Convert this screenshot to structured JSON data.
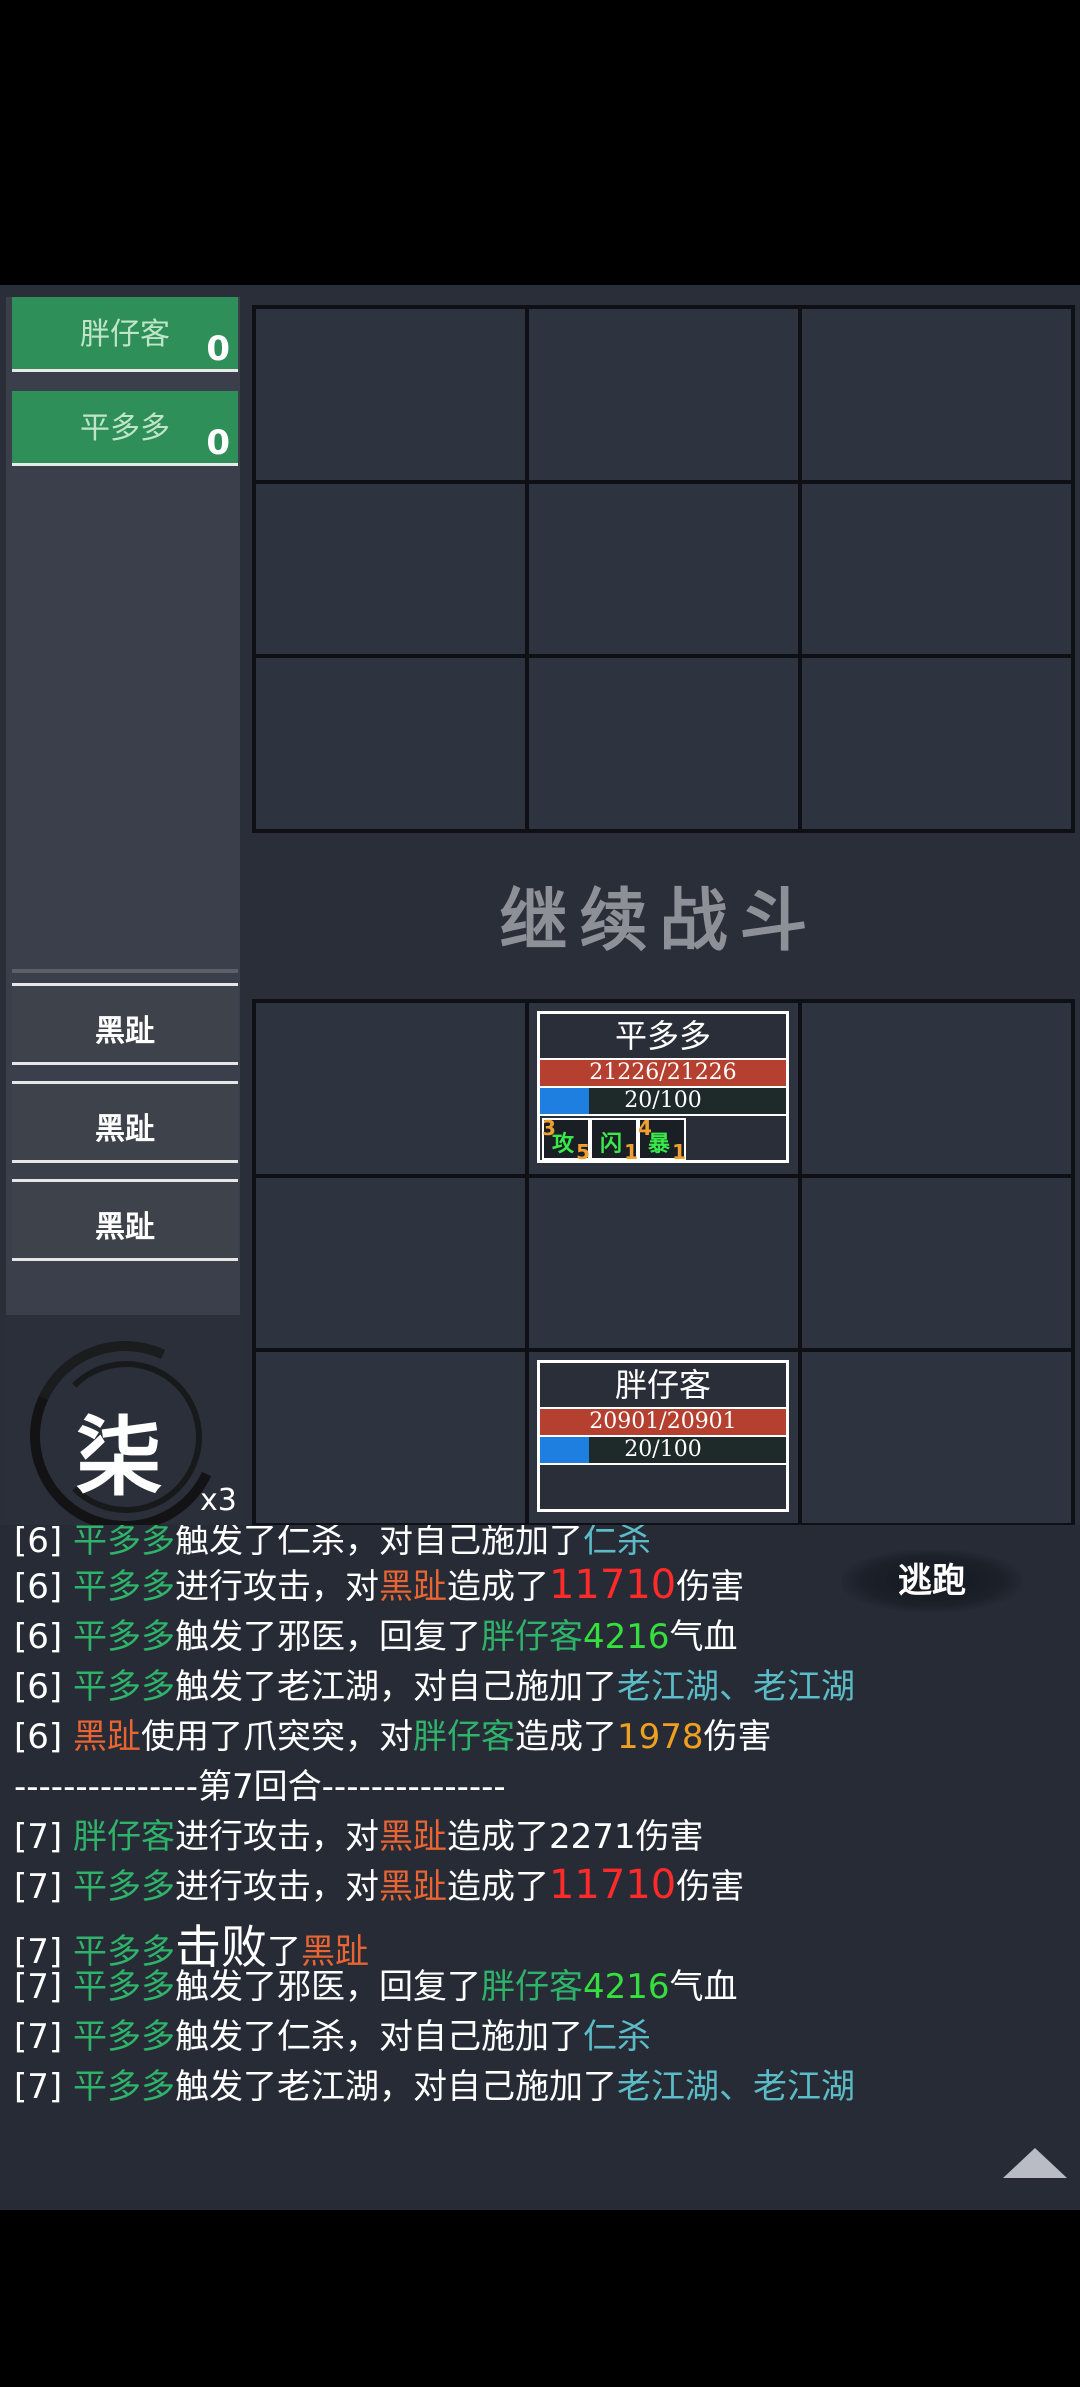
{
  "allies": [
    {
      "name": "胖仔客",
      "score": "0"
    },
    {
      "name": "平多多",
      "score": "0"
    }
  ],
  "enemies": [
    "黑趾",
    "黑趾",
    "黑趾"
  ],
  "turn": {
    "char": "柒",
    "multiplier": "x3"
  },
  "continue_label": "继续战斗",
  "units": {
    "top": {
      "name": "平多多",
      "hp": "21226/21226",
      "mp": "20/100",
      "mp_fraction": 0.2,
      "buffs": [
        {
          "name": "攻",
          "left": "3",
          "right": "5"
        },
        {
          "name": "闪",
          "left": "",
          "right": "1"
        },
        {
          "name": "暴",
          "left": "4",
          "right": "1"
        }
      ]
    },
    "bottom": {
      "name": "胖仔客",
      "hp": "20901/20901",
      "mp": "20/100",
      "mp_fraction": 0.2
    }
  },
  "flee_label": "逃跑",
  "log": [
    {
      "parts": [
        [
          "w",
          "[6] "
        ],
        [
          "g",
          "平多多"
        ],
        [
          "w",
          "触发了仁杀，对自己施加了"
        ],
        [
          "c",
          "仁杀"
        ]
      ]
    },
    {
      "parts": [
        [
          "w",
          "[6] "
        ],
        [
          "g",
          "平多多"
        ],
        [
          "w",
          "进行攻击，对"
        ],
        [
          "r",
          "黑趾"
        ],
        [
          "w",
          "造成了"
        ],
        [
          "red",
          "11710"
        ],
        [
          "w",
          "伤害"
        ]
      ]
    },
    {
      "parts": [
        [
          "w",
          "[6] "
        ],
        [
          "g",
          "平多多"
        ],
        [
          "w",
          "触发了邪医，回复了"
        ],
        [
          "g",
          "胖仔客"
        ],
        [
          "lg",
          "4216"
        ],
        [
          "w",
          "气血"
        ]
      ]
    },
    {
      "parts": [
        [
          "w",
          "[6] "
        ],
        [
          "g",
          "平多多"
        ],
        [
          "w",
          "触发了老江湖，对自己施加了"
        ],
        [
          "c",
          "老江湖、老江湖"
        ]
      ]
    },
    {
      "parts": [
        [
          "w",
          "[6] "
        ],
        [
          "r",
          "黑趾"
        ],
        [
          "w",
          "使用了爪突突，对"
        ],
        [
          "g",
          "胖仔客"
        ],
        [
          "w",
          "造成了"
        ],
        [
          "o",
          "1978"
        ],
        [
          "w",
          "伤害"
        ]
      ]
    },
    {
      "parts": [
        [
          "w",
          "---------------第7回合---------------"
        ]
      ]
    },
    {
      "parts": [
        [
          "w",
          "[7] "
        ],
        [
          "g",
          "胖仔客"
        ],
        [
          "w",
          "进行攻击，对"
        ],
        [
          "r",
          "黑趾"
        ],
        [
          "w",
          "造成了2271伤害"
        ]
      ]
    },
    {
      "parts": [
        [
          "w",
          "[7] "
        ],
        [
          "g",
          "平多多"
        ],
        [
          "w",
          "进行攻击，对"
        ],
        [
          "r",
          "黑趾"
        ],
        [
          "w",
          "造成了"
        ],
        [
          "red",
          "11710"
        ],
        [
          "w",
          "伤害"
        ]
      ]
    },
    {
      "parts": [
        [
          "w",
          "[7] "
        ],
        [
          "g",
          "平多多"
        ],
        [
          "w",
          "击败"
        ],
        [
          "w",
          "了"
        ],
        [
          "r",
          "黑趾"
        ]
      ]
    },
    {
      "parts": [
        [
          "w",
          "[7] "
        ],
        [
          "g",
          "平多多"
        ],
        [
          "w",
          "触发了邪医，回复了"
        ],
        [
          "g",
          "胖仔客"
        ],
        [
          "lg",
          "4216"
        ],
        [
          "w",
          "气血"
        ]
      ]
    },
    {
      "parts": [
        [
          "w",
          "[7] "
        ],
        [
          "g",
          "平多多"
        ],
        [
          "w",
          "触发了仁杀，对自己施加了"
        ],
        [
          "c",
          "仁杀"
        ]
      ]
    },
    {
      "parts": [
        [
          "w",
          "[7] "
        ],
        [
          "g",
          "平多多"
        ],
        [
          "w",
          "触发了老江湖，对自己施加了"
        ],
        [
          "c",
          "老江湖、老江湖"
        ]
      ]
    }
  ]
}
